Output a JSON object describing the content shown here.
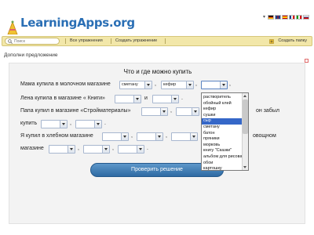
{
  "header": {
    "logo_text": "LearningApps.org",
    "language_flags": [
      "de",
      "en",
      "es",
      "fr",
      "it",
      "ru"
    ]
  },
  "nav": {
    "search_placeholder": "Поиск",
    "all_exercises": "Все упражнения",
    "create_exercise": "Создать упражнение",
    "create_folder": "Создать папку"
  },
  "page": {
    "subtitle": "Дополни предложение"
  },
  "task": {
    "title": "Что и где можно купить",
    "line1": {
      "text": "Мама купила в молочном магазине",
      "select1": "сметану",
      "select2": "кефир",
      "select3": ""
    },
    "line2": {
      "text_before": "Лена купила в магазине « Книги»",
      "conj": "и"
    },
    "line3": {
      "text_before": "Папа купил в магазине «Стройматериалы»",
      "text_after": "он забыл",
      "text_wrap": "купить"
    },
    "line4": {
      "text_before": "Я купил в хлебном магазине",
      "text_after": "овощном",
      "text_wrap": "магазине"
    }
  },
  "dropdown": {
    "options": [
      "растворитель",
      "обойный клей",
      "кефир",
      "сушки",
      "сыр",
      "сметану",
      "батон",
      "пряники",
      "морковь",
      "книгу \"Сказки\"",
      "альбом для рисования",
      "обои",
      "картошку"
    ],
    "highlighted_index": 4
  },
  "check_button": "Проверить решение",
  "colors": {
    "navbar": "#f2e7a9",
    "accent": "#2a6fb5",
    "button": "#2e6aa3",
    "highlight": "#3567c8"
  }
}
